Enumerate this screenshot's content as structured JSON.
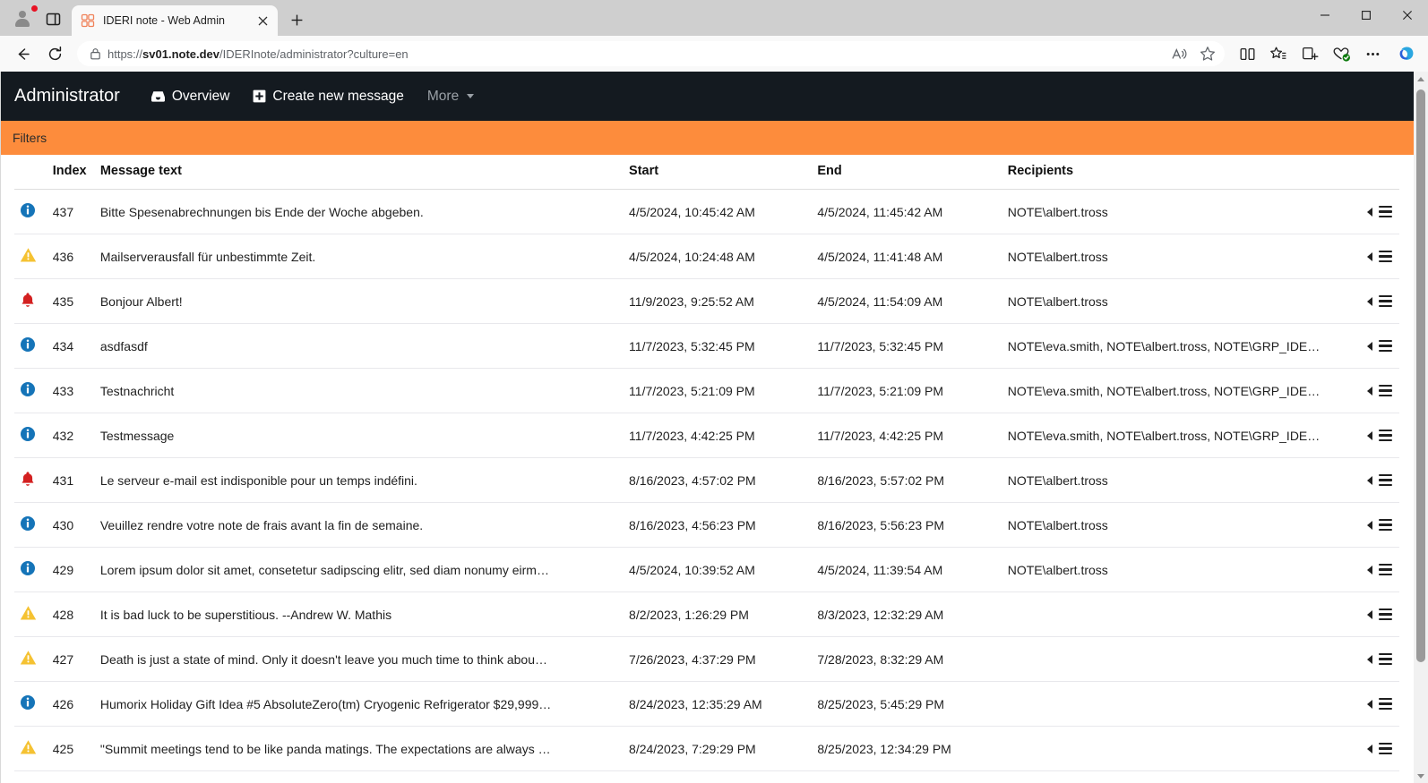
{
  "browser": {
    "tab": {
      "title": "IDERI note - Web Admin",
      "favicon_icon": "ideri-note-favicon"
    },
    "new_tab_label": "+",
    "url_prefix": "https://",
    "url_bold": "sv01.note.dev",
    "url_suffix": "/IDERInote/administrator?culture=en",
    "url_full": "https://sv01.note.dev/IDERInote/administrator?culture=en",
    "toolbar_icons": [
      "read-aloud-icon",
      "favorite-star-icon",
      "split-screen-icon",
      "favorites-list-icon",
      "collections-icon",
      "browser-essentials-icon",
      "more-options-icon",
      "copilot-icon"
    ],
    "window_controls": [
      "minimize-button",
      "maximize-button",
      "close-button"
    ]
  },
  "app": {
    "brand": "Administrator",
    "nav": [
      {
        "label": "Overview",
        "icon": "inbox-icon"
      },
      {
        "label": "Create new message",
        "icon": "plus-square-icon"
      },
      {
        "label": "More",
        "icon": "chevron-down-icon",
        "muted": true
      }
    ],
    "filters_label": "Filters",
    "accent_color": "#fd8c3c",
    "navbar_color": "#141a20"
  },
  "table": {
    "columns": [
      "",
      "Index",
      "Message text",
      "Start",
      "End",
      "Recipients",
      ""
    ],
    "severity_colors": {
      "information": "#1574b8",
      "warning": "#f5c232",
      "alarm": "#d32020"
    },
    "rows": [
      {
        "severity": "information",
        "severity_icon": "info-circle-icon",
        "index": "437",
        "message": "Bitte Spesenabrechnungen bis Ende der Woche abgeben.",
        "start": "4/5/2024, 10:45:42 AM",
        "end": "4/5/2024, 11:45:42 AM",
        "recipients": "NOTE\\albert.tross"
      },
      {
        "severity": "warning",
        "severity_icon": "warning-triangle-icon",
        "index": "436",
        "message": "Mailserverausfall für unbestimmte Zeit.",
        "start": "4/5/2024, 10:24:48 AM",
        "end": "4/5/2024, 11:41:48 AM",
        "recipients": "NOTE\\albert.tross"
      },
      {
        "severity": "alarm",
        "severity_icon": "alarm-bell-icon",
        "index": "435",
        "message": "Bonjour Albert!",
        "start": "11/9/2023, 9:25:52 AM",
        "end": "4/5/2024, 11:54:09 AM",
        "recipients": "NOTE\\albert.tross"
      },
      {
        "severity": "information",
        "severity_icon": "info-circle-icon",
        "index": "434",
        "message": "asdfasdf",
        "start": "11/7/2023, 5:32:45 PM",
        "end": "11/7/2023, 5:32:45 PM",
        "recipients": "NOTE\\eva.smith, NOTE\\albert.tross, NOTE\\GRP_IDE…"
      },
      {
        "severity": "information",
        "severity_icon": "info-circle-icon",
        "index": "433",
        "message": "Testnachricht",
        "start": "11/7/2023, 5:21:09 PM",
        "end": "11/7/2023, 5:21:09 PM",
        "recipients": "NOTE\\eva.smith, NOTE\\albert.tross, NOTE\\GRP_IDE…"
      },
      {
        "severity": "information",
        "severity_icon": "info-circle-icon",
        "index": "432",
        "message": "Testmessage",
        "start": "11/7/2023, 4:42:25 PM",
        "end": "11/7/2023, 4:42:25 PM",
        "recipients": "NOTE\\eva.smith, NOTE\\albert.tross, NOTE\\GRP_IDE…"
      },
      {
        "severity": "alarm",
        "severity_icon": "alarm-bell-icon",
        "index": "431",
        "message": "Le serveur e-mail est indisponible pour un temps indéfini.",
        "start": "8/16/2023, 4:57:02 PM",
        "end": "8/16/2023, 5:57:02 PM",
        "recipients": "NOTE\\albert.tross"
      },
      {
        "severity": "information",
        "severity_icon": "info-circle-icon",
        "index": "430",
        "message": "Veuillez rendre votre note de frais avant la fin de semaine.",
        "start": "8/16/2023, 4:56:23 PM",
        "end": "8/16/2023, 5:56:23 PM",
        "recipients": "NOTE\\albert.tross"
      },
      {
        "severity": "information",
        "severity_icon": "info-circle-icon",
        "index": "429",
        "message": "Lorem ipsum dolor sit amet, consetetur sadipscing elitr, sed diam nonumy eirm…",
        "start": "4/5/2024, 10:39:52 AM",
        "end": "4/5/2024, 11:39:54 AM",
        "recipients": "NOTE\\albert.tross"
      },
      {
        "severity": "warning",
        "severity_icon": "warning-triangle-icon",
        "index": "428",
        "message": "It is bad luck to be superstitious. --Andrew W. Mathis",
        "start": "8/2/2023, 1:26:29 PM",
        "end": "8/3/2023, 12:32:29 AM",
        "recipients": ""
      },
      {
        "severity": "warning",
        "severity_icon": "warning-triangle-icon",
        "index": "427",
        "message": "Death is just a state of mind. Only it doesn't leave you much time to think abou…",
        "start": "7/26/2023, 4:37:29 PM",
        "end": "7/28/2023, 8:32:29 AM",
        "recipients": ""
      },
      {
        "severity": "information",
        "severity_icon": "info-circle-icon",
        "index": "426",
        "message": "Humorix Holiday Gift Idea #5 AbsoluteZero(tm) Cryogenic Refrigerator $29,999…",
        "start": "8/24/2023, 12:35:29 AM",
        "end": "8/25/2023, 5:45:29 PM",
        "recipients": ""
      },
      {
        "severity": "warning",
        "severity_icon": "warning-triangle-icon",
        "index": "425",
        "message": "\"Summit meetings tend to be like panda matings. The expectations are always …",
        "start": "8/24/2023, 7:29:29 PM",
        "end": "8/25/2023, 12:34:29 PM",
        "recipients": ""
      }
    ],
    "row_action_icons": [
      "collapse-arrow-icon",
      "row-menu-icon"
    ]
  }
}
